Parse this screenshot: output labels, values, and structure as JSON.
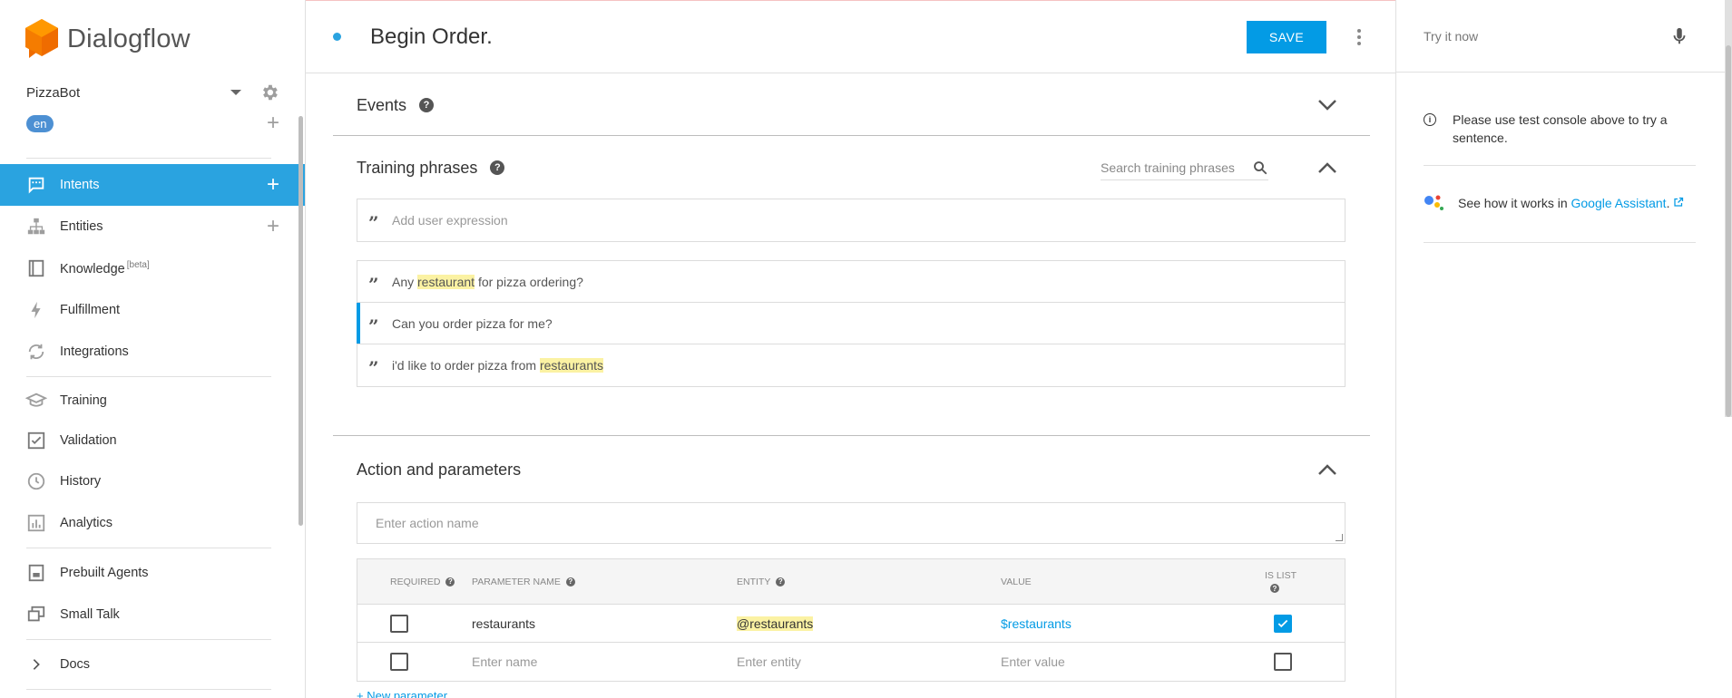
{
  "app": {
    "name": "Dialogflow"
  },
  "sidebar": {
    "agent_name": "PizzaBot",
    "language": "en",
    "items": [
      {
        "label": "Intents",
        "icon": "chat-icon",
        "active": true
      },
      {
        "label": "Entities",
        "icon": "hierarchy-icon"
      },
      {
        "label": "Knowledge",
        "icon": "book-icon",
        "badge": "[beta]"
      },
      {
        "label": "Fulfillment",
        "icon": "bolt-icon"
      },
      {
        "label": "Integrations",
        "icon": "sync-icon"
      },
      {
        "label": "Training",
        "icon": "graduation-cap-icon"
      },
      {
        "label": "Validation",
        "icon": "check-square-icon"
      },
      {
        "label": "History",
        "icon": "clock-icon"
      },
      {
        "label": "Analytics",
        "icon": "bar-chart-icon"
      },
      {
        "label": "Prebuilt Agents",
        "icon": "prebuilt-icon"
      },
      {
        "label": "Small Talk",
        "icon": "small-talk-icon"
      },
      {
        "label": "Docs",
        "icon": "chevron-right-icon"
      }
    ]
  },
  "header": {
    "title": "Begin Order.",
    "save_label": "SAVE"
  },
  "events": {
    "title": "Events"
  },
  "training": {
    "title": "Training phrases",
    "search_placeholder": "Search training phrases",
    "add_placeholder": "Add user expression",
    "phrases": [
      {
        "before": "Any ",
        "entity": "restaurant",
        "after": " for pizza ordering?"
      },
      {
        "before": "Can you order pizza for me?",
        "entity": "",
        "after": ""
      },
      {
        "before": "i'd like to order pizza from ",
        "entity": "restaurants",
        "after": ""
      }
    ]
  },
  "actions": {
    "title": "Action and parameters",
    "action_placeholder": "Enter action name",
    "columns": {
      "required": "REQUIRED",
      "param_name": "PARAMETER NAME",
      "entity": "ENTITY",
      "value": "VALUE",
      "is_list_1": "IS LIST"
    },
    "rows": [
      {
        "name": "restaurants",
        "entity": "@restaurants",
        "value": "$restaurants",
        "required": false,
        "is_list": true
      }
    ],
    "new_row": {
      "name_placeholder": "Enter name",
      "entity_placeholder": "Enter entity",
      "value_placeholder": "Enter value"
    },
    "new_parameter_label": "+ New parameter"
  },
  "right_panel": {
    "try_placeholder": "Try it now",
    "info_text": "Please use test console above to try a sentence.",
    "ga_text": "See how it works in ",
    "ga_link": "Google Assistant",
    "ga_suffix": "."
  }
}
